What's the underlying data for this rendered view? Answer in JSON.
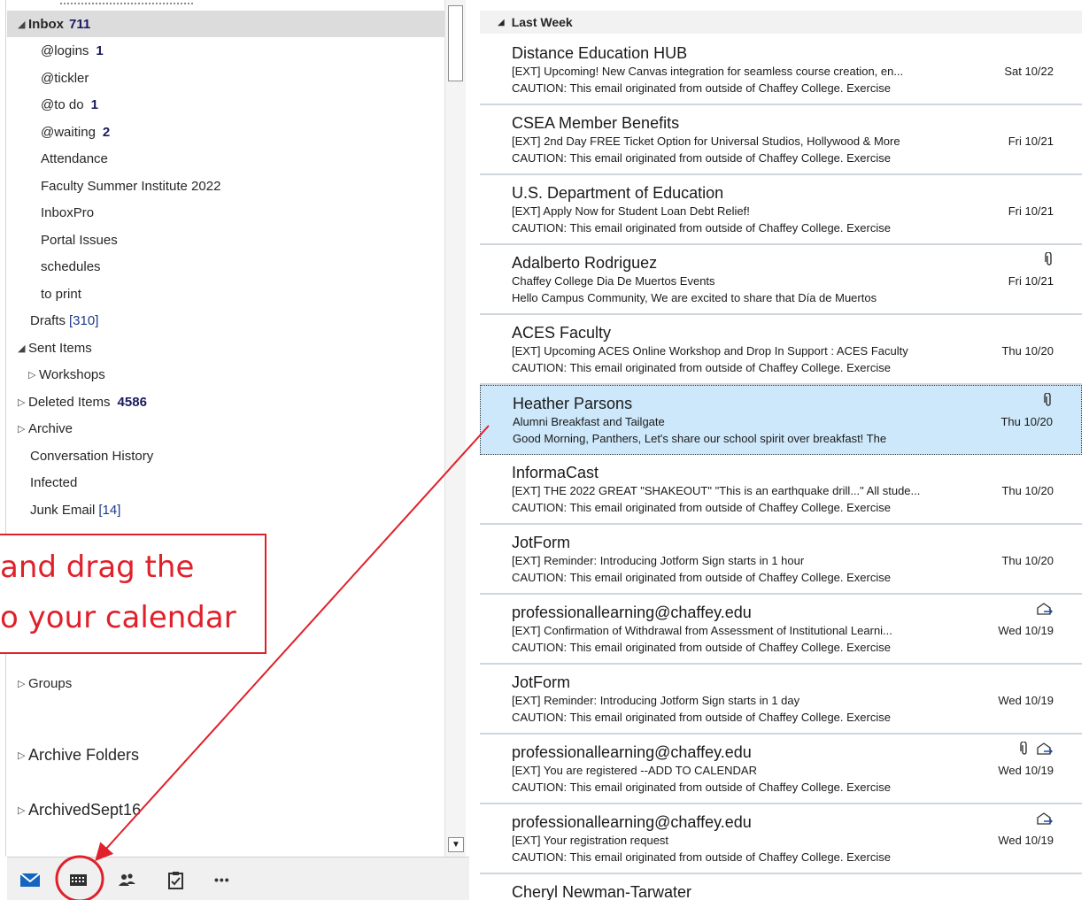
{
  "folders": [
    {
      "name": "Inbox",
      "count": "711",
      "toggle": "◢"
    },
    {
      "name": "@logins",
      "count": "1"
    },
    {
      "name": "@tickler"
    },
    {
      "name": "@to do",
      "count": "1"
    },
    {
      "name": "@waiting",
      "count": "2"
    },
    {
      "name": "Attendance"
    },
    {
      "name": "Faculty Summer Institute 2022"
    },
    {
      "name": "InboxPro"
    },
    {
      "name": "Portal Issues"
    },
    {
      "name": "schedules"
    },
    {
      "name": "to print"
    },
    {
      "name": "Drafts",
      "bracket": "[310]"
    },
    {
      "name": "Sent Items",
      "toggle": "◢"
    },
    {
      "name": "Workshops",
      "toggle": "▷"
    },
    {
      "name": "Deleted Items",
      "count": "4586",
      "toggle": "▷"
    },
    {
      "name": "Archive",
      "toggle": "▷"
    },
    {
      "name": "Conversation History"
    },
    {
      "name": "Infected"
    },
    {
      "name": "Junk Email",
      "bracket": "[14]"
    },
    {
      "name": "Groups",
      "toggle": "▷"
    },
    {
      "name": "Archive Folders",
      "toggle": "▷"
    },
    {
      "name": "ArchivedSept16",
      "toggle": "▷"
    }
  ],
  "nav": {
    "icons": [
      "mail-icon",
      "calendar-icon",
      "people-icon",
      "tasks-icon",
      "more-icon"
    ],
    "more_label": "•••"
  },
  "message_list": {
    "group_label": "Last Week",
    "group_toggle": "◢",
    "messages": [
      {
        "sender": "Distance Education HUB",
        "subject": "[EXT] Upcoming! New Canvas integration for seamless course creation, en...",
        "preview": "CAUTION: This email originated from outside of Chaffey College. Exercise",
        "date": "Sat 10/22"
      },
      {
        "sender": "CSEA Member Benefits",
        "subject": "[EXT] 2nd Day FREE Ticket Option for Universal Studios, Hollywood & More",
        "preview": "CAUTION: This email originated from outside of Chaffey College. Exercise",
        "date": "Fri 10/21"
      },
      {
        "sender": "U.S. Department of Education",
        "subject": "[EXT] Apply Now for Student Loan Debt Relief!",
        "preview": "CAUTION: This email originated from outside of Chaffey College. Exercise",
        "date": "Fri 10/21"
      },
      {
        "sender": "Adalberto Rodriguez",
        "subject": "Chaffey College Dia De Muertos Events",
        "preview": "Hello Campus Community,   We are excited to share that Día de Muertos",
        "date": "Fri 10/21"
      },
      {
        "sender": "ACES Faculty",
        "subject": "[EXT] Upcoming ACES Online Workshop and Drop In Support : ACES Faculty",
        "preview": "CAUTION: This email originated from outside of Chaffey College. Exercise",
        "date": "Thu 10/20"
      },
      {
        "sender": "Heather Parsons",
        "subject": "Alumni Breakfast and Tailgate",
        "preview": "Good Morning, Panthers,   Let's share our school spirit over breakfast! The",
        "date": "Thu 10/20"
      },
      {
        "sender": "InformaCast",
        "subject": "[EXT] THE 2022 GREAT \"SHAKEOUT\" \"This is an earthquake drill...\" All stude...",
        "preview": "CAUTION: This email originated from outside of Chaffey College. Exercise",
        "date": "Thu 10/20"
      },
      {
        "sender": "JotForm",
        "subject": "[EXT] Reminder: Introducing Jotform Sign starts in 1 hour",
        "preview": "CAUTION: This email originated from outside of Chaffey College. Exercise",
        "date": "Thu 10/20"
      },
      {
        "sender": "professionallearning@chaffey.edu",
        "subject": "[EXT] Confirmation of Withdrawal from Assessment of Institutional Learni...",
        "preview": "CAUTION: This email originated from outside of Chaffey College. Exercise",
        "date": "Wed 10/19"
      },
      {
        "sender": "JotForm",
        "subject": "[EXT] Reminder: Introducing Jotform Sign starts in 1 day",
        "preview": "CAUTION: This email originated from outside of Chaffey College. Exercise",
        "date": "Wed 10/19"
      },
      {
        "sender": "professionallearning@chaffey.edu",
        "subject": "[EXT] You are registered --ADD TO CALENDAR",
        "preview": "CAUTION: This email originated from outside of Chaffey College. Exercise",
        "date": "Wed 10/19"
      },
      {
        "sender": "professionallearning@chaffey.edu",
        "subject": "[EXT] Your registration request",
        "preview": "CAUTION: This email originated from outside of Chaffey College. Exercise",
        "date": "Wed 10/19"
      },
      {
        "sender": "Cheryl Newman-Tarwater",
        "subject": "",
        "preview": "",
        "date": ""
      }
    ]
  },
  "annotation": {
    "line1": "and drag the",
    "line2": "o your calendar",
    "color": "#e0202a"
  }
}
